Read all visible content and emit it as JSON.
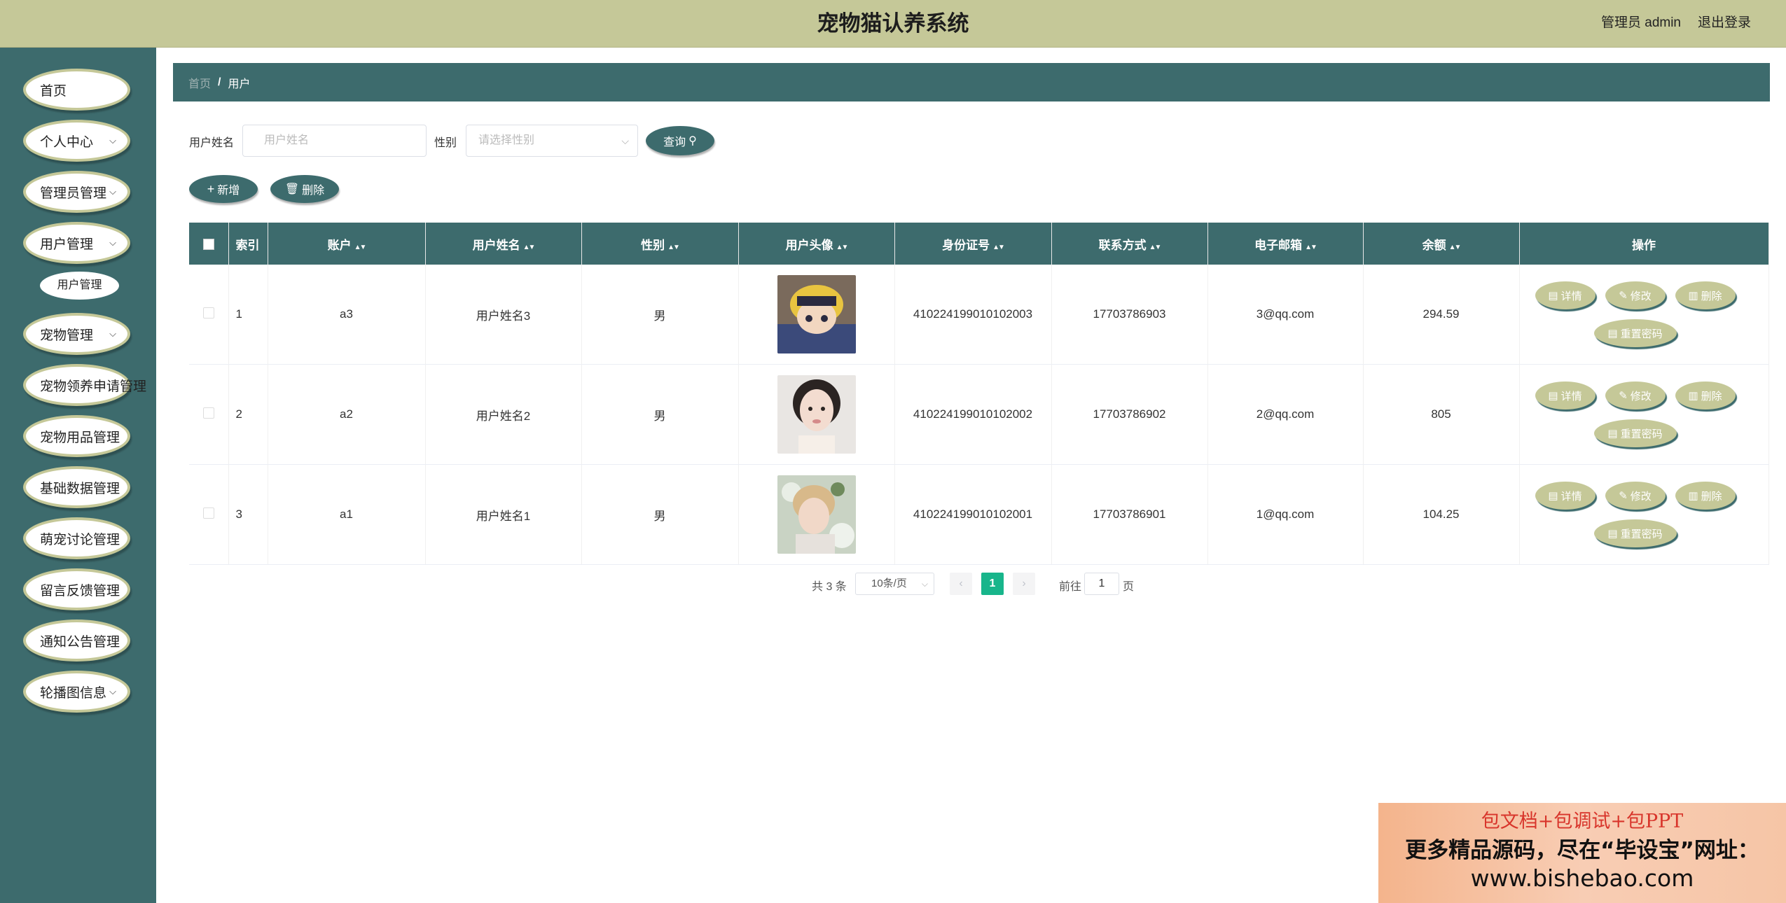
{
  "header": {
    "title": "宠物猫认养系统",
    "admin_label": "管理员 admin",
    "logout_label": "退出登录"
  },
  "sidebar": {
    "items": [
      {
        "label": "首页"
      },
      {
        "label": "个人中心"
      },
      {
        "label": "管理员管理"
      },
      {
        "label": "用户管理"
      },
      {
        "label": "宠物管理"
      },
      {
        "label": "宠物领养申请管理"
      },
      {
        "label": "宠物用品管理"
      },
      {
        "label": "基础数据管理"
      },
      {
        "label": "萌宠讨论管理"
      },
      {
        "label": "留言反馈管理"
      },
      {
        "label": "通知公告管理"
      },
      {
        "label": "轮播图信息"
      }
    ],
    "submenu": {
      "label": "用户管理"
    }
  },
  "breadcrumb": {
    "home": "首页",
    "sep": "/",
    "current": "用户"
  },
  "search": {
    "name_label": "用户姓名",
    "name_placeholder": "用户姓名",
    "gender_label": "性别",
    "gender_placeholder": "请选择性别",
    "query_label": "查询"
  },
  "toolbar": {
    "add_label": "新增",
    "delete_label": "删除"
  },
  "table": {
    "headers": [
      "索引",
      "账户",
      "用户姓名",
      "性别",
      "用户头像",
      "身份证号",
      "联系方式",
      "电子邮箱",
      "余额",
      "操作"
    ],
    "rows": [
      {
        "index": "1",
        "account": "a3",
        "name": "用户姓名3",
        "gender": "男",
        "id_card": "410224199010102003",
        "phone": "17703786903",
        "email": "3@qq.com",
        "balance": "294.59"
      },
      {
        "index": "2",
        "account": "a2",
        "name": "用户姓名2",
        "gender": "男",
        "id_card": "410224199010102002",
        "phone": "17703786902",
        "email": "2@qq.com",
        "balance": "805"
      },
      {
        "index": "3",
        "account": "a1",
        "name": "用户姓名1",
        "gender": "男",
        "id_card": "410224199010102001",
        "phone": "17703786901",
        "email": "1@qq.com",
        "balance": "104.25"
      }
    ],
    "actions": {
      "detail": "详情",
      "edit": "修改",
      "delete": "删除",
      "reset": "重置密码"
    }
  },
  "pagination": {
    "total": "共 3 条",
    "page_size": "10条/页",
    "current_page": "1",
    "goto_label": "前往",
    "goto_value": "1",
    "page_unit": "页"
  },
  "ad": {
    "line1": "包文档+包调试+包PPT",
    "line2": "更多精品源码，尽在“毕设宝”网址：",
    "line3": "www.bishebao.com"
  },
  "colors": {
    "primary": "#3d6b6d",
    "accent": "#c5c898",
    "pager_active": "#18b58b"
  }
}
